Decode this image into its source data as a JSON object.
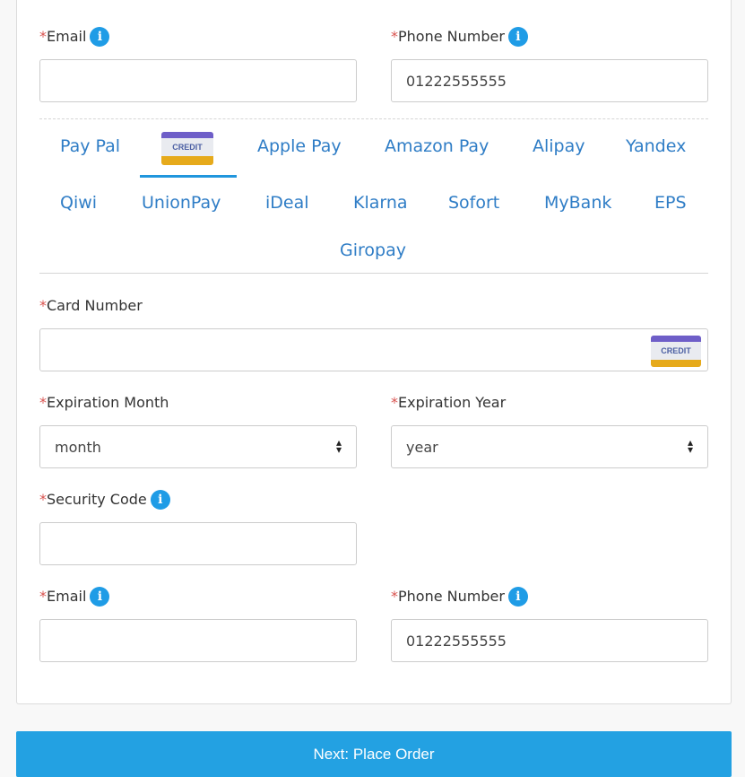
{
  "form": {
    "email_label": "Email",
    "phone_label": "Phone Number",
    "phone_value": "01222555555",
    "card_number_label": "Card Number",
    "exp_month_label": "Expiration Month",
    "exp_month_value": "month",
    "exp_year_label": "Expiration Year",
    "exp_year_value": "year",
    "security_code_label": "Security Code",
    "email2_label": "Email",
    "phone2_label": "Phone Number",
    "phone2_value": "01222555555",
    "required_mark": "*",
    "info_glyph": "i"
  },
  "payment_tabs": {
    "row1": [
      "Pay Pal",
      "CREDIT",
      "Apple Pay",
      "Amazon Pay",
      "Alipay",
      "Yandex"
    ],
    "row2": [
      "Qiwi",
      "UnionPay",
      "iDeal",
      "Klarna",
      "Sofort",
      "MyBank",
      "EPS"
    ],
    "row3": [
      "Giropay"
    ],
    "active": "CREDIT"
  },
  "card_badge": "CREDIT",
  "button": {
    "next_label": "Next: Place Order"
  },
  "colors": {
    "accent": "#23a1e2",
    "link": "#2f7dc6",
    "required": "#d9534f"
  }
}
